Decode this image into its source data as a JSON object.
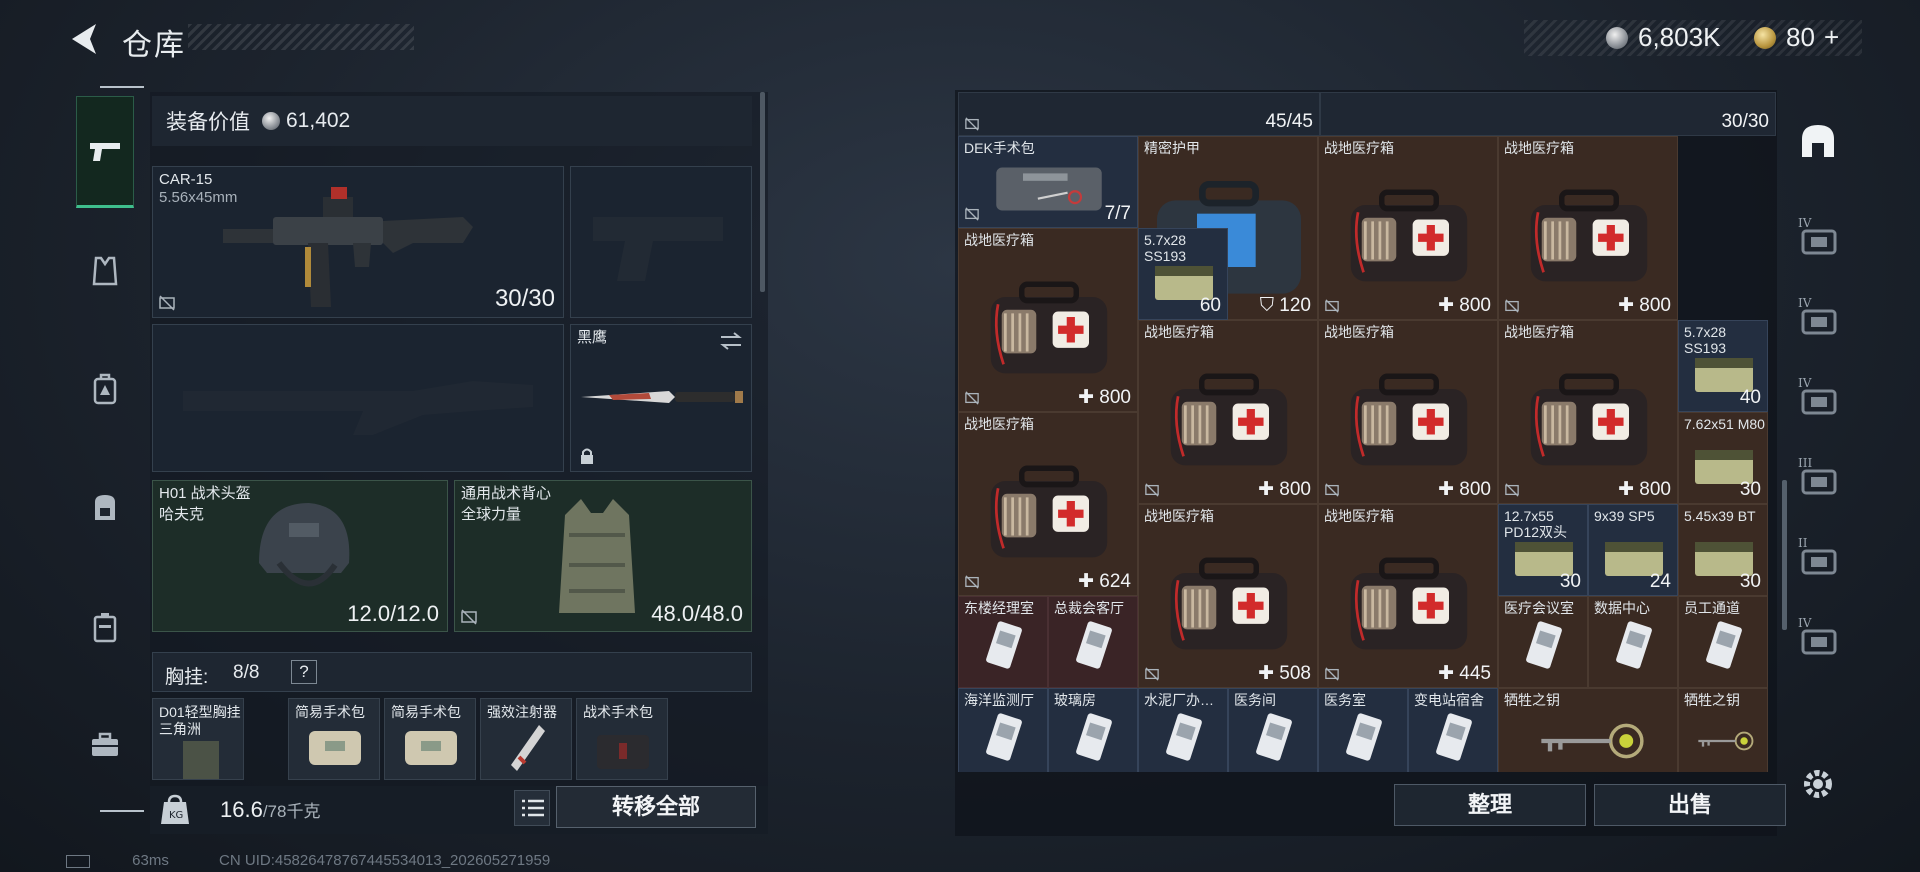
{
  "header": {
    "title": "仓库",
    "silver_amount": "6,803K",
    "gold_amount": "80",
    "gold_plus": "+"
  },
  "equipment": {
    "value_label": "装备价值",
    "value_amount": "61,402",
    "primary": {
      "name": "CAR-15",
      "ammo": "5.56x45mm",
      "durability": "30/30"
    },
    "melee": {
      "name": "黑鹰"
    },
    "helmet": {
      "name": "H01 战术头盔",
      "sub": "哈夫克",
      "durability": "12.0/12.0"
    },
    "vest": {
      "name": "通用战术背心",
      "sub": "全球力量",
      "durability": "48.0/48.0"
    },
    "chest_label": "胸挂:",
    "chest_count": "8/8",
    "chest_help": "?",
    "pockets": [
      {
        "name": "D01轻型胸挂",
        "sub": "三角洲"
      },
      {
        "name": "简易手术包",
        "sub": ""
      },
      {
        "name": "简易手术包",
        "sub": ""
      },
      {
        "name": "强效注射器",
        "sub": ""
      },
      {
        "name": "战术手术包",
        "sub": ""
      }
    ],
    "weight_current": "16.6",
    "weight_max": "/78千克",
    "transfer_label": "转移全部"
  },
  "stash": {
    "top_counts": [
      "45/45",
      "30/30"
    ],
    "items": [
      {
        "name": "DEK手术包",
        "value": "7/7"
      },
      {
        "name": "精密护甲",
        "value": "120"
      },
      {
        "name": "战地医疗箱",
        "value": "800"
      },
      {
        "name": "战地医疗箱",
        "value": "800"
      },
      {
        "name": "战地医疗箱",
        "value": "800"
      },
      {
        "name": "5.7x28 SS193",
        "value": "60"
      },
      {
        "name": "战地医疗箱",
        "value": "800"
      },
      {
        "name": "战地医疗箱",
        "value": "800"
      },
      {
        "name": "战地医疗箱",
        "value": "800"
      },
      {
        "name": "5.7x28 SS193",
        "value": "40"
      },
      {
        "name": "7.62x51 M80",
        "value": "30"
      },
      {
        "name": "战地医疗箱",
        "value": "624"
      },
      {
        "name": "战地医疗箱",
        "value": "508"
      },
      {
        "name": "战地医疗箱",
        "value": "445"
      },
      {
        "name": "12.7x55 PD12双头",
        "value": "30"
      },
      {
        "name": "9x39 SP5",
        "value": "24"
      },
      {
        "name": "5.45x39 BT",
        "value": "30"
      },
      {
        "name": "东楼经理室",
        "value": ""
      },
      {
        "name": "总裁会客厅",
        "value": ""
      },
      {
        "name": "医疗会议室",
        "value": ""
      },
      {
        "name": "数据中心",
        "value": ""
      },
      {
        "name": "员工通道",
        "value": ""
      },
      {
        "name": "海洋监测厅",
        "value": ""
      },
      {
        "name": "玻璃房",
        "value": ""
      },
      {
        "name": "水泥厂办…",
        "value": ""
      },
      {
        "name": "医务间",
        "value": ""
      },
      {
        "name": "医务室",
        "value": ""
      },
      {
        "name": "变电站宿舍",
        "value": ""
      },
      {
        "name": "牺牲之钥",
        "value": ""
      },
      {
        "name": "牺牲之钥",
        "value": ""
      }
    ],
    "sort_label": "整理",
    "sell_label": "出售"
  },
  "rail_tabs": [
    "IV",
    "IV",
    "IV",
    "III",
    "II",
    "IV"
  ],
  "status": {
    "ping": "63ms",
    "uid": "CN UID:4582647876744553401​3_202605271959"
  },
  "colors": {
    "accent_green": "#3fbf8d",
    "brown_cell": "#3a2a22",
    "blue_cell": "#232e40"
  }
}
